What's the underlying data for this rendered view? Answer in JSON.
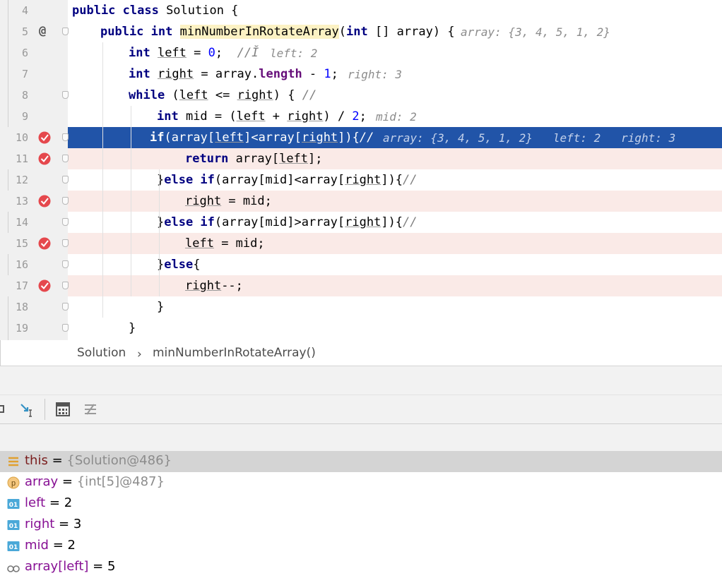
{
  "editor": {
    "lines": [
      {
        "num": "4",
        "code": [
          {
            "t": "public class ",
            "c": "kw"
          },
          {
            "t": "Solution {",
            "c": ""
          }
        ],
        "hint": ""
      },
      {
        "num": "5",
        "code": [
          {
            "t": "public int ",
            "c": "kw"
          },
          {
            "t": "minNumberInRotateArray",
            "c": "meth"
          },
          {
            "t": "(",
            "c": ""
          },
          {
            "t": "int ",
            "c": "kw"
          },
          {
            "t": "[] array) {",
            "c": ""
          }
        ],
        "hint": "array: {3, 4, 5, 1, 2}"
      },
      {
        "num": "6",
        "code": [
          {
            "t": "int ",
            "c": "kw"
          },
          {
            "t": "left",
            "c": "var"
          },
          {
            "t": " = ",
            "c": ""
          },
          {
            "t": "0",
            "c": "num"
          },
          {
            "t": ";  ",
            "c": ""
          },
          {
            "t": "//Ĭ",
            "c": "cm"
          }
        ],
        "hint": "left: 2"
      },
      {
        "num": "7",
        "code": [
          {
            "t": "int ",
            "c": "kw"
          },
          {
            "t": "right",
            "c": "var"
          },
          {
            "t": " = array.",
            "c": ""
          },
          {
            "t": "length",
            "c": "fld"
          },
          {
            "t": " - ",
            "c": ""
          },
          {
            "t": "1",
            "c": "num"
          },
          {
            "t": ";",
            "c": ""
          }
        ],
        "hint": "right: 3"
      },
      {
        "num": "8",
        "code": [
          {
            "t": "while ",
            "c": "kw"
          },
          {
            "t": "(",
            "c": ""
          },
          {
            "t": "left",
            "c": "var"
          },
          {
            "t": " <= ",
            "c": ""
          },
          {
            "t": "right",
            "c": "var"
          },
          {
            "t": ") { ",
            "c": ""
          },
          {
            "t": "//",
            "c": "cm"
          }
        ],
        "hint": ""
      },
      {
        "num": "9",
        "code": [
          {
            "t": "int ",
            "c": "kw"
          },
          {
            "t": "mid = (",
            "c": ""
          },
          {
            "t": "left",
            "c": "var"
          },
          {
            "t": " + ",
            "c": ""
          },
          {
            "t": "right",
            "c": "var"
          },
          {
            "t": ") / ",
            "c": ""
          },
          {
            "t": "2",
            "c": "num"
          },
          {
            "t": ";",
            "c": ""
          }
        ],
        "hint": "mid: 2"
      },
      {
        "num": "10",
        "code": [
          {
            "t": "if",
            "c": "kw"
          },
          {
            "t": "(array[",
            "c": ""
          },
          {
            "t": "left",
            "c": "var"
          },
          {
            "t": "]<array[",
            "c": ""
          },
          {
            "t": "right",
            "c": "var"
          },
          {
            "t": "]){",
            "c": ""
          },
          {
            "t": "//",
            "c": "cm"
          }
        ],
        "hint": "array: {3, 4, 5, 1, 2}   left: 2   right: 3"
      },
      {
        "num": "11",
        "code": [
          {
            "t": "return ",
            "c": "kw"
          },
          {
            "t": "array[",
            "c": ""
          },
          {
            "t": "left",
            "c": "var"
          },
          {
            "t": "];",
            "c": ""
          }
        ],
        "hint": ""
      },
      {
        "num": "12",
        "code": [
          {
            "t": "}",
            "c": ""
          },
          {
            "t": "else if",
            "c": "kw"
          },
          {
            "t": "(array[mid]<array[",
            "c": ""
          },
          {
            "t": "right",
            "c": "var"
          },
          {
            "t": "]){",
            "c": ""
          },
          {
            "t": "//",
            "c": "cm"
          }
        ],
        "hint": ""
      },
      {
        "num": "13",
        "code": [
          {
            "t": "right",
            "c": "var"
          },
          {
            "t": " = mid;",
            "c": ""
          }
        ],
        "hint": ""
      },
      {
        "num": "14",
        "code": [
          {
            "t": "}",
            "c": ""
          },
          {
            "t": "else if",
            "c": "kw"
          },
          {
            "t": "(array[mid]>array[",
            "c": ""
          },
          {
            "t": "right",
            "c": "var"
          },
          {
            "t": "]){",
            "c": ""
          },
          {
            "t": "//",
            "c": "cm"
          }
        ],
        "hint": ""
      },
      {
        "num": "15",
        "code": [
          {
            "t": "left",
            "c": "var"
          },
          {
            "t": " = mid;",
            "c": ""
          }
        ],
        "hint": ""
      },
      {
        "num": "16",
        "code": [
          {
            "t": "}",
            "c": ""
          },
          {
            "t": "else",
            "c": "kw"
          },
          {
            "t": "{",
            "c": ""
          }
        ],
        "hint": ""
      },
      {
        "num": "17",
        "code": [
          {
            "t": "right",
            "c": "var"
          },
          {
            "t": "--;",
            "c": ""
          }
        ],
        "hint": ""
      },
      {
        "num": "18",
        "code": [
          {
            "t": "}",
            "c": ""
          }
        ],
        "hint": ""
      },
      {
        "num": "19",
        "code": [
          {
            "t": "}",
            "c": ""
          }
        ],
        "hint": ""
      }
    ],
    "current_line": "10",
    "breakpoint_lines": [
      "10",
      "11",
      "13",
      "15",
      "17"
    ],
    "override_marker": "@"
  },
  "breadcrumb": {
    "class": "Solution",
    "method": "minNumberInRotateArray()"
  },
  "toolbar": {
    "icons": [
      "step-icon",
      "evaluate-expression-icon",
      "calculator-icon",
      "settings-icon"
    ]
  },
  "variables": [
    {
      "name": "this",
      "eq": " = ",
      "value": "{Solution@486}",
      "icon": "object-icon",
      "value_style": "ref"
    },
    {
      "name": "array",
      "eq": " = ",
      "value": "{int[5]@487}",
      "icon": "parameter-icon",
      "value_style": "ref"
    },
    {
      "name": "left",
      "eq": " = ",
      "value": "2",
      "icon": "primitive-icon",
      "value_style": "num"
    },
    {
      "name": "right",
      "eq": " = ",
      "value": "3",
      "icon": "primitive-icon",
      "value_style": "num"
    },
    {
      "name": "mid",
      "eq": " = ",
      "value": "2",
      "icon": "primitive-icon",
      "value_style": "num"
    },
    {
      "name": "array[left]",
      "eq": " = ",
      "value": "5",
      "icon": "watch-icon",
      "value_style": "num"
    }
  ],
  "colors": {
    "current_line_bg": "#2154a8",
    "breakpoint_line_bg": "#faeae7",
    "breakpoint_red": "#e5484d",
    "keyword": "#000080",
    "comment": "#808080",
    "hint": "#8c8c8c"
  }
}
